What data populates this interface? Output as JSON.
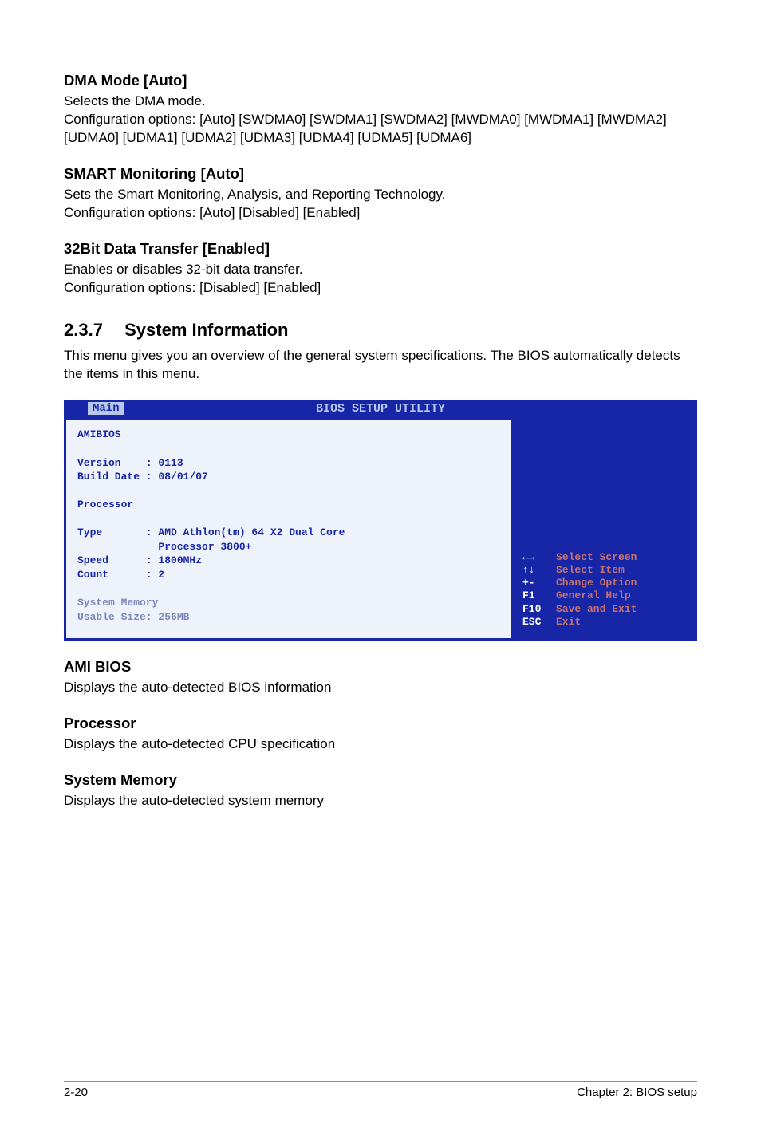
{
  "sections": {
    "dma": {
      "heading": "DMA Mode [Auto]",
      "line1": "Selects the DMA mode.",
      "line2": "Configuration options: [Auto] [SWDMA0] [SWDMA1] [SWDMA2] [MWDMA0] [MWDMA1] [MWDMA2] [UDMA0] [UDMA1] [UDMA2] [UDMA3] [UDMA4] [UDMA5] [UDMA6]"
    },
    "smart": {
      "heading": "SMART Monitoring [Auto]",
      "line1": "Sets the Smart Monitoring, Analysis, and Reporting Technology.",
      "line2": "Configuration options: [Auto] [Disabled] [Enabled]"
    },
    "bit32": {
      "heading": "32Bit Data Transfer [Enabled]",
      "line1": "Enables or disables 32-bit data transfer.",
      "line2": "Configuration options: [Disabled] [Enabled]"
    },
    "sysinfo": {
      "num": "2.3.7",
      "title": "System Information",
      "desc": "This menu gives you an overview of the general system specifications. The BIOS automatically detects the items in this menu."
    },
    "amibios": {
      "heading": "AMI BIOS",
      "text": "Displays the auto-detected BIOS information"
    },
    "processor": {
      "heading": "Processor",
      "text": "Displays the auto-detected CPU specification"
    },
    "sysmem": {
      "heading": "System Memory",
      "text": "Displays the auto-detected system memory"
    }
  },
  "bios": {
    "title": "BIOS SETUP UTILITY",
    "tab": "Main",
    "left_text": "AMIBIOS\n\nVersion    : 0113\nBuild Date : 08/01/07\n\nProcessor\n\nType       : AMD Athlon(tm) 64 X2 Dual Core\n             Processor 3800+\nSpeed      : 1800MHz\nCount      : 2\n",
    "left_dim": "System Memory\nUsable Size: 256MB",
    "help": [
      {
        "key": "←→",
        "txt": "Select Screen"
      },
      {
        "key": "↑↓",
        "txt": "Select Item"
      },
      {
        "key": "+-",
        "txt": "Change Option"
      },
      {
        "key": "F1",
        "txt": "General Help"
      },
      {
        "key": "F10",
        "txt": "Save and Exit"
      },
      {
        "key": "ESC",
        "txt": "Exit"
      }
    ]
  },
  "footer": {
    "left": "2-20",
    "right": "Chapter 2: BIOS setup"
  }
}
